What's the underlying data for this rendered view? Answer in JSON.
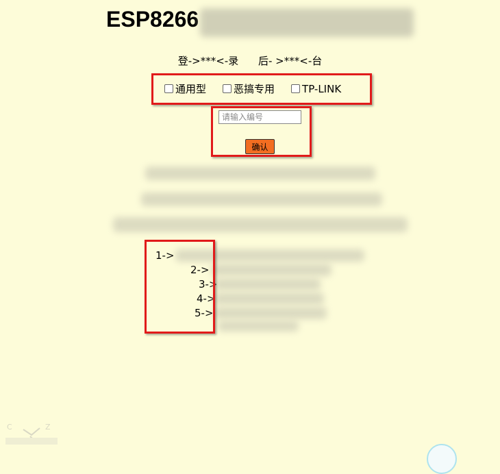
{
  "header": {
    "title": "ESP8266"
  },
  "login_line": {
    "left": "登->***<-录",
    "right": "后- >***<-台"
  },
  "device_options": [
    {
      "label": "通用型",
      "checked": false
    },
    {
      "label": "恶搞专用",
      "checked": false
    },
    {
      "label": "TP-LINK",
      "checked": false
    }
  ],
  "number_input": {
    "placeholder": "请输入编号",
    "value": ""
  },
  "confirm_button": {
    "label": "确认",
    "color": "#f26d21"
  },
  "list": {
    "items": [
      "1->",
      "2->",
      "3->",
      "4->",
      "5->"
    ]
  },
  "colors": {
    "background": "#fdfcd9",
    "highlight_box": "#e11a1a"
  }
}
